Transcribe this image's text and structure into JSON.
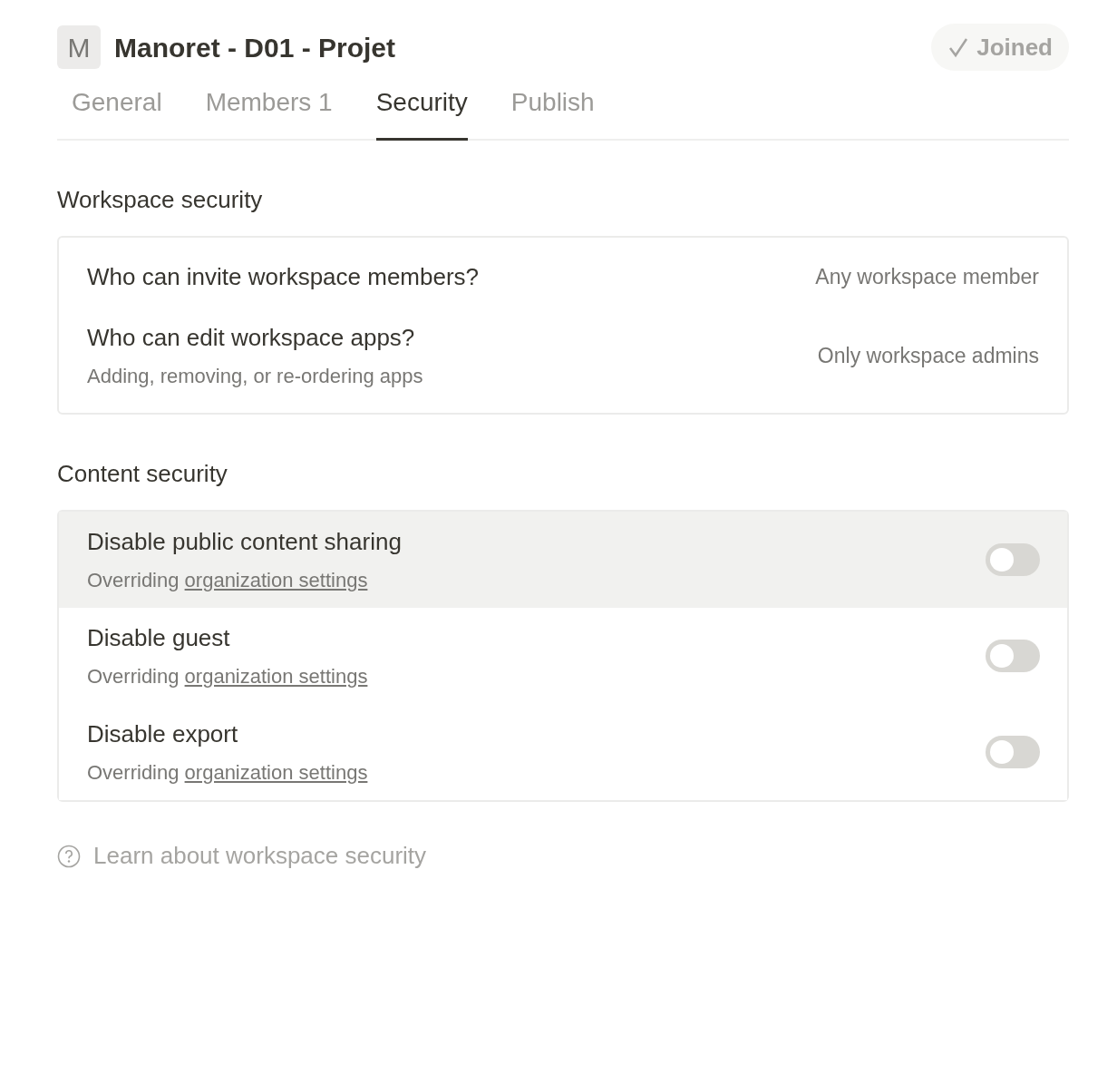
{
  "workspace": {
    "initial": "M",
    "name": "Manoret - D01 - Projet",
    "status_button": "Joined"
  },
  "tabs": [
    {
      "label": "General",
      "selected": false
    },
    {
      "label": "Members 1",
      "selected": false
    },
    {
      "label": "Security",
      "selected": true
    },
    {
      "label": "Publish",
      "selected": false
    }
  ],
  "workspace_security": {
    "title": "Workspace security",
    "rows": [
      {
        "label": "Who can invite workspace members?",
        "value": "Any workspace member"
      },
      {
        "label": "Who can edit workspace apps?",
        "description": "Adding, removing, or re-ordering apps",
        "value": "Only workspace admins"
      }
    ]
  },
  "content_security": {
    "title": "Content security",
    "rows": [
      {
        "label": "Disable public content sharing",
        "note": "Overriding",
        "link": "organization settings",
        "on": false,
        "highlighted": true
      },
      {
        "label": "Disable guest",
        "note": "Overriding",
        "link": "organization settings",
        "on": false,
        "highlighted": false
      },
      {
        "label": "Disable export",
        "note": "Overriding",
        "link": "organization settings",
        "on": false,
        "highlighted": false
      }
    ]
  },
  "help_link": "Learn about workspace security"
}
